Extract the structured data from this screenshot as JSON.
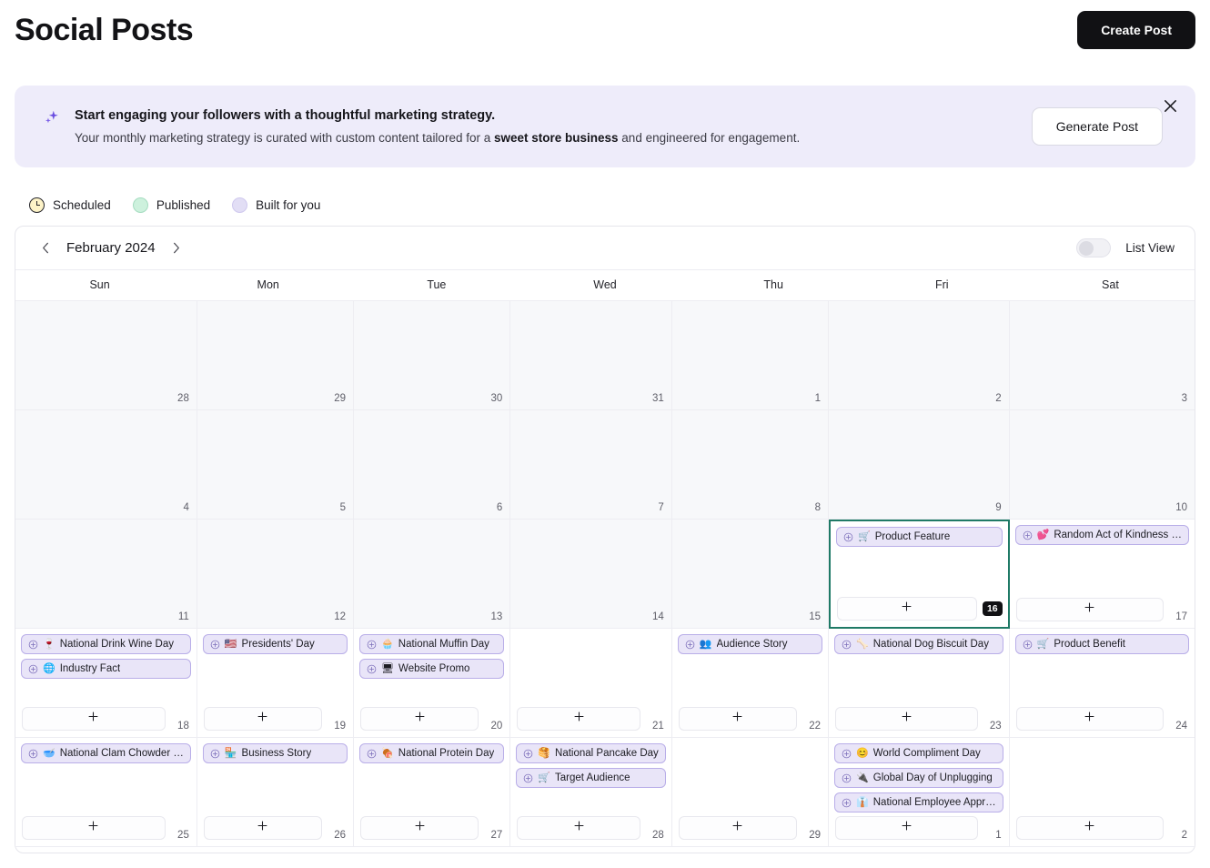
{
  "header": {
    "title": "Social Posts",
    "create_post_label": "Create Post"
  },
  "banner": {
    "icon": "sparkles-icon",
    "title": "Start engaging your followers with a thoughtful marketing strategy.",
    "sub_prefix": "Your monthly marketing strategy is curated with custom content tailored for a ",
    "sub_bold": "sweet store business",
    "sub_suffix": " and engineered for engagement.",
    "generate_post_label": "Generate Post",
    "close_icon": "close-icon"
  },
  "legend": {
    "items": [
      {
        "label": "Scheduled",
        "kind": "scheduled",
        "color": "#fdf3c8"
      },
      {
        "label": "Published",
        "kind": "published",
        "color": "#cdf1dd"
      },
      {
        "label": "Built for you",
        "kind": "builtforyou",
        "color": "#e2def5"
      }
    ]
  },
  "calendar": {
    "month_label": "February 2024",
    "prev_icon": "chevron-left-icon",
    "next_icon": "chevron-right-icon",
    "list_view_label": "List View",
    "list_view_toggle_on": false,
    "day_headers": [
      "Sun",
      "Mon",
      "Tue",
      "Wed",
      "Thu",
      "Fri",
      "Sat"
    ],
    "today": 16,
    "accent_today": "#1f7a66",
    "chip_bg": "#e9e5f8",
    "chip_border": "#b9aee8",
    "days": [
      {
        "num": "28",
        "in_month": false,
        "today": false,
        "add_slot": false,
        "events": []
      },
      {
        "num": "29",
        "in_month": false,
        "today": false,
        "add_slot": false,
        "events": []
      },
      {
        "num": "30",
        "in_month": false,
        "today": false,
        "add_slot": false,
        "events": []
      },
      {
        "num": "31",
        "in_month": false,
        "today": false,
        "add_slot": false,
        "events": []
      },
      {
        "num": "1",
        "in_month": false,
        "today": false,
        "add_slot": false,
        "events": []
      },
      {
        "num": "2",
        "in_month": false,
        "today": false,
        "add_slot": false,
        "events": []
      },
      {
        "num": "3",
        "in_month": false,
        "today": false,
        "add_slot": false,
        "events": []
      },
      {
        "num": "4",
        "in_month": false,
        "today": false,
        "add_slot": false,
        "events": []
      },
      {
        "num": "5",
        "in_month": false,
        "today": false,
        "add_slot": false,
        "events": []
      },
      {
        "num": "6",
        "in_month": false,
        "today": false,
        "add_slot": false,
        "events": []
      },
      {
        "num": "7",
        "in_month": false,
        "today": false,
        "add_slot": false,
        "events": []
      },
      {
        "num": "8",
        "in_month": false,
        "today": false,
        "add_slot": false,
        "events": []
      },
      {
        "num": "9",
        "in_month": false,
        "today": false,
        "add_slot": false,
        "events": []
      },
      {
        "num": "10",
        "in_month": false,
        "today": false,
        "add_slot": false,
        "events": []
      },
      {
        "num": "11",
        "in_month": false,
        "today": false,
        "add_slot": false,
        "events": []
      },
      {
        "num": "12",
        "in_month": false,
        "today": false,
        "add_slot": false,
        "events": []
      },
      {
        "num": "13",
        "in_month": false,
        "today": false,
        "add_slot": false,
        "events": []
      },
      {
        "num": "14",
        "in_month": false,
        "today": false,
        "add_slot": false,
        "events": []
      },
      {
        "num": "15",
        "in_month": false,
        "today": false,
        "add_slot": false,
        "events": []
      },
      {
        "num": "16",
        "in_month": true,
        "today": true,
        "add_slot": true,
        "events": [
          {
            "emoji": "🛒",
            "label": "Product Feature"
          }
        ]
      },
      {
        "num": "17",
        "in_month": true,
        "today": false,
        "add_slot": true,
        "events": [
          {
            "emoji": "💕",
            "label": "Random Act of Kindness …"
          }
        ]
      },
      {
        "num": "18",
        "in_month": true,
        "today": false,
        "add_slot": true,
        "events": [
          {
            "emoji": "🍷",
            "label": "National Drink Wine Day"
          },
          {
            "emoji": "🌐",
            "label": "Industry Fact"
          }
        ]
      },
      {
        "num": "19",
        "in_month": true,
        "today": false,
        "add_slot": true,
        "events": [
          {
            "emoji": "🇺🇸",
            "label": "Presidents' Day"
          }
        ]
      },
      {
        "num": "20",
        "in_month": true,
        "today": false,
        "add_slot": true,
        "events": [
          {
            "emoji": "🧁",
            "label": "National Muffin Day"
          },
          {
            "emoji": "🖥",
            "label": "Website Promo"
          }
        ]
      },
      {
        "num": "21",
        "in_month": true,
        "today": false,
        "add_slot": true,
        "events": []
      },
      {
        "num": "22",
        "in_month": true,
        "today": false,
        "add_slot": true,
        "events": [
          {
            "emoji": "👥",
            "label": "Audience Story"
          }
        ]
      },
      {
        "num": "23",
        "in_month": true,
        "today": false,
        "add_slot": true,
        "events": [
          {
            "emoji": "🦴",
            "label": "National Dog Biscuit Day"
          }
        ]
      },
      {
        "num": "24",
        "in_month": true,
        "today": false,
        "add_slot": true,
        "events": [
          {
            "emoji": "🛒",
            "label": "Product Benefit"
          }
        ]
      },
      {
        "num": "25",
        "in_month": true,
        "today": false,
        "add_slot": true,
        "events": [
          {
            "emoji": "🥣",
            "label": "National Clam Chowder …"
          }
        ]
      },
      {
        "num": "26",
        "in_month": true,
        "today": false,
        "add_slot": true,
        "events": [
          {
            "emoji": "🏪",
            "label": "Business Story"
          }
        ]
      },
      {
        "num": "27",
        "in_month": true,
        "today": false,
        "add_slot": true,
        "events": [
          {
            "emoji": "🍖",
            "label": "National Protein Day"
          }
        ]
      },
      {
        "num": "28",
        "in_month": true,
        "today": false,
        "add_slot": true,
        "events": [
          {
            "emoji": "🥞",
            "label": "National Pancake Day"
          },
          {
            "emoji": "🛒",
            "label": "Target Audience"
          }
        ]
      },
      {
        "num": "29",
        "in_month": true,
        "today": false,
        "add_slot": true,
        "events": []
      },
      {
        "num": "1",
        "in_month": true,
        "today": false,
        "add_slot": true,
        "events": [
          {
            "emoji": "😊",
            "label": "World Compliment Day"
          },
          {
            "emoji": "🔌",
            "label": "Global Day of Unplugging"
          },
          {
            "emoji": "👔",
            "label": "National Employee Appr…"
          }
        ]
      },
      {
        "num": "2",
        "in_month": true,
        "today": false,
        "add_slot": true,
        "events": []
      }
    ]
  }
}
